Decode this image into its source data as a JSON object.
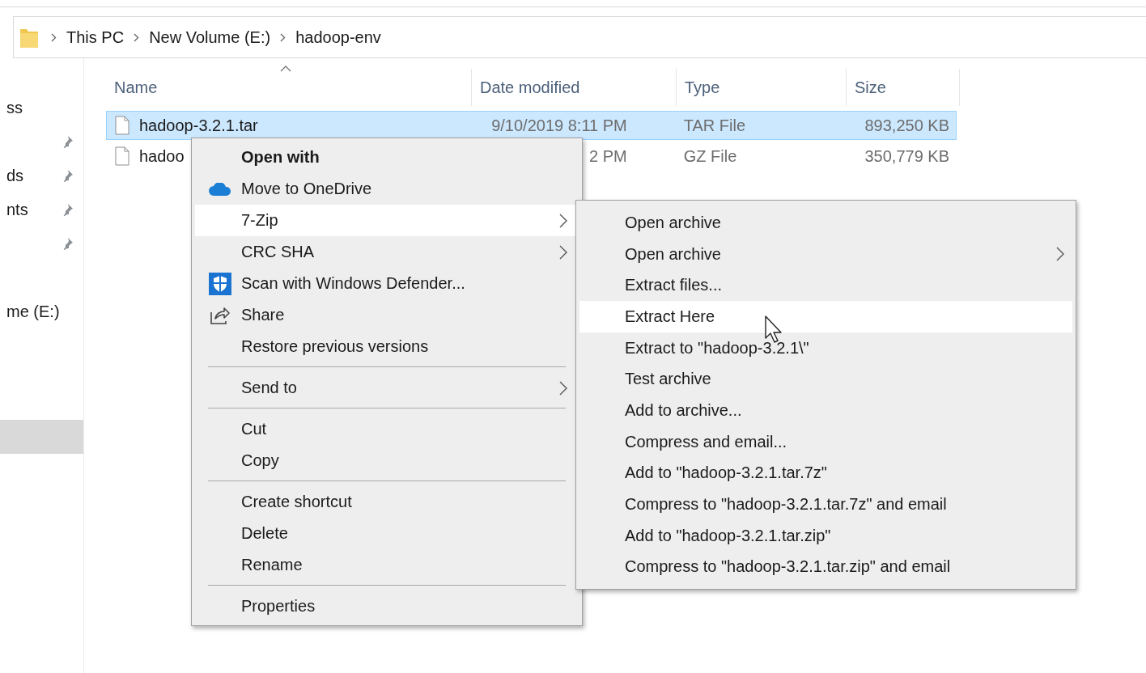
{
  "address_bar": {
    "crumbs": [
      "This PC",
      "New Volume (E:)",
      "hadoop-env"
    ]
  },
  "sidebar": {
    "sections": [
      {
        "items": [
          {
            "label": "ss",
            "pinned": false,
            "selected": false
          },
          {
            "pinned": true,
            "selected": false
          },
          {
            "label": "ds",
            "pinned": true,
            "selected": false
          },
          {
            "label": "nts",
            "pinned": true,
            "selected": false
          },
          {
            "pinned": true,
            "selected": false
          }
        ]
      },
      {
        "items": [
          {
            "label": "me (E:)",
            "pinned": false,
            "selected": false
          }
        ]
      },
      {
        "items": [
          {
            "pinned": false,
            "selected": true
          }
        ]
      }
    ]
  },
  "file_list": {
    "columns": [
      "Name",
      "Date modified",
      "Type",
      "Size"
    ],
    "rows": [
      {
        "name": "hadoop-3.2.1.tar",
        "date": "9/10/2019 8:11 PM",
        "type": "TAR File",
        "size": "893,250 KB",
        "selected": true
      },
      {
        "name": "hadoo",
        "date": "2 PM",
        "type": "GZ File",
        "size": "350,779 KB",
        "selected": false
      }
    ]
  },
  "context_menu": {
    "items": [
      {
        "kind": "default",
        "label": "Open with",
        "submenu": false,
        "selected": false
      },
      {
        "kind": "onedrive",
        "label": "Move to OneDrive",
        "submenu": false,
        "selected": false
      },
      {
        "kind": "plain",
        "label": "7-Zip",
        "submenu": true,
        "selected": true
      },
      {
        "kind": "plain",
        "label": "CRC SHA",
        "submenu": true,
        "selected": false
      },
      {
        "kind": "defender",
        "label": "Scan with Windows Defender...",
        "submenu": false,
        "selected": false
      },
      {
        "kind": "share",
        "label": "Share",
        "submenu": false,
        "selected": false
      },
      {
        "kind": "plain",
        "label": "Restore previous versions",
        "submenu": false,
        "selected": false
      },
      {
        "kind": "separator"
      },
      {
        "kind": "plain",
        "label": "Send to",
        "submenu": true,
        "selected": false
      },
      {
        "kind": "separator"
      },
      {
        "kind": "plain",
        "label": "Cut",
        "submenu": false,
        "selected": false
      },
      {
        "kind": "plain",
        "label": "Copy",
        "submenu": false,
        "selected": false
      },
      {
        "kind": "separator"
      },
      {
        "kind": "plain",
        "label": "Create shortcut",
        "submenu": false,
        "selected": false
      },
      {
        "kind": "plain",
        "label": "Delete",
        "submenu": false,
        "selected": false
      },
      {
        "kind": "plain",
        "label": "Rename",
        "submenu": false,
        "selected": false
      },
      {
        "kind": "separator"
      },
      {
        "kind": "plain",
        "label": "Properties",
        "submenu": false,
        "selected": false
      }
    ]
  },
  "submenu": {
    "items": [
      {
        "label": "Open archive",
        "submenu": false,
        "selected": false
      },
      {
        "label": "Open archive",
        "submenu": true,
        "selected": false
      },
      {
        "label": "Extract files...",
        "submenu": false,
        "selected": false
      },
      {
        "label": "Extract Here",
        "submenu": false,
        "selected": true
      },
      {
        "label": "Extract to \"hadoop-3.2.1\\\"",
        "submenu": false,
        "selected": false
      },
      {
        "label": "Test archive",
        "submenu": false,
        "selected": false
      },
      {
        "label": "Add to archive...",
        "submenu": false,
        "selected": false
      },
      {
        "label": "Compress and email...",
        "submenu": false,
        "selected": false
      },
      {
        "label": "Add to \"hadoop-3.2.1.tar.7z\"",
        "submenu": false,
        "selected": false
      },
      {
        "label": "Compress to \"hadoop-3.2.1.tar.7z\" and email",
        "submenu": false,
        "selected": false
      },
      {
        "label": "Add to \"hadoop-3.2.1.tar.zip\"",
        "submenu": false,
        "selected": false
      },
      {
        "label": "Compress to \"hadoop-3.2.1.tar.zip\" and email",
        "submenu": false,
        "selected": false
      }
    ]
  }
}
